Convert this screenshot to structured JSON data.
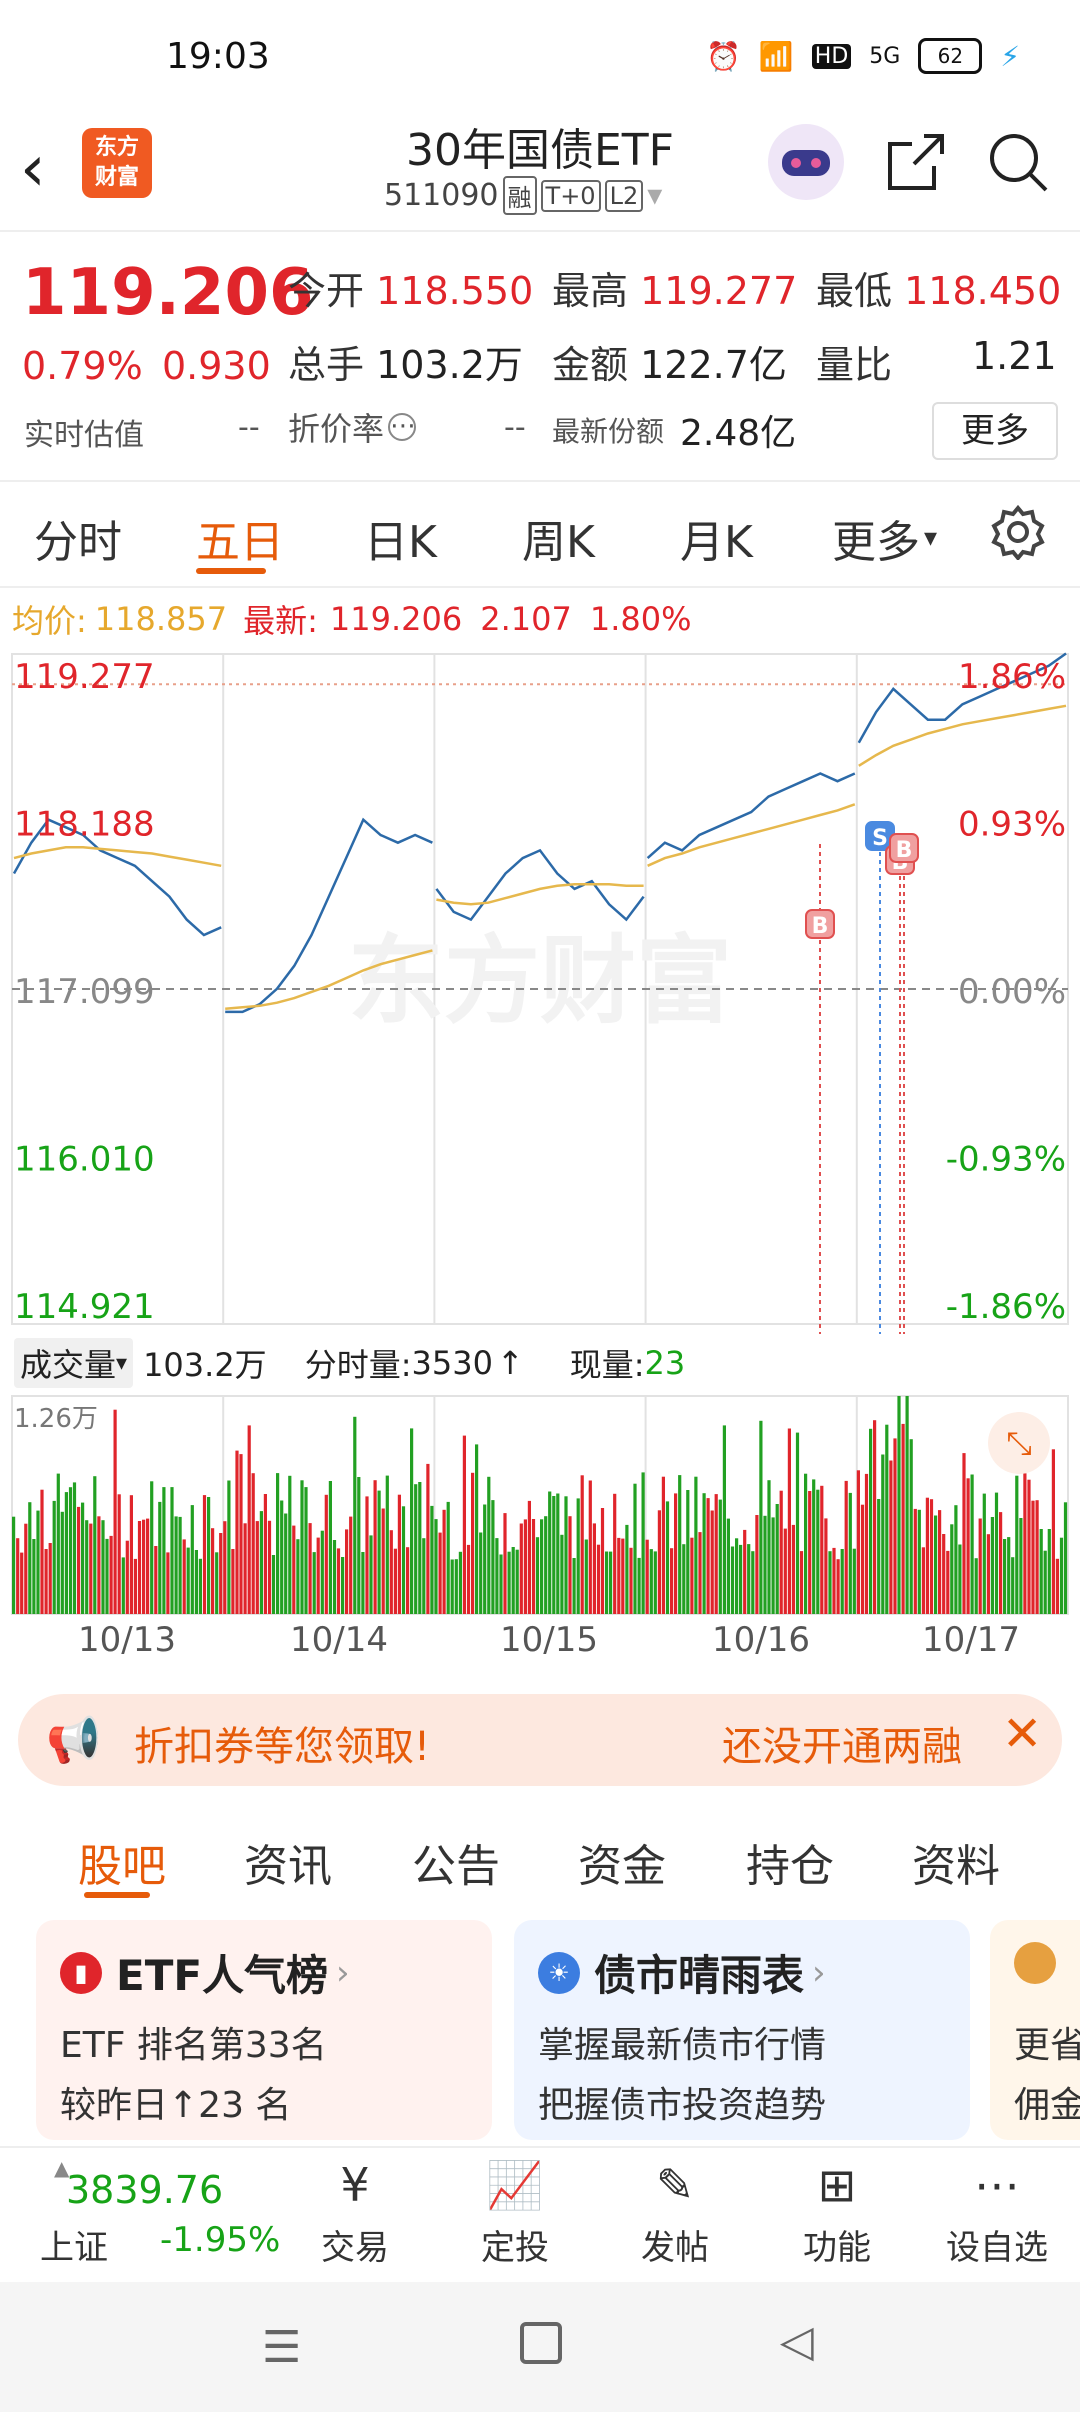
{
  "status_bar": {
    "time": "19:03",
    "network": "5G",
    "hd": "HD",
    "battery": "62"
  },
  "header": {
    "logo_text": [
      "东方",
      "财富"
    ],
    "title": "30年国债ETF",
    "code": "511090",
    "tags": [
      "融",
      "T+0",
      "L2"
    ]
  },
  "quote": {
    "price": "119.206",
    "change_pct": "0.79%",
    "change": "0.930",
    "open_label": "今开",
    "open": "118.550",
    "high_label": "最高",
    "high": "119.277",
    "low_label": "最低",
    "low": "118.450",
    "volume_label": "总手",
    "volume": "103.2万",
    "amount_label": "金额",
    "amount": "122.7亿",
    "ratio_label": "量比",
    "ratio": "1.21",
    "iopv_label": "实时估值",
    "iopv": "--",
    "premium_label": "折价率",
    "premium": "--",
    "shares_label": "最新份额",
    "shares": "2.48亿",
    "more_button": "更多"
  },
  "chart_tabs": [
    {
      "label": "分时",
      "active": false
    },
    {
      "label": "五日",
      "active": true
    },
    {
      "label": "日K",
      "active": false
    },
    {
      "label": "周K",
      "active": false
    },
    {
      "label": "月K",
      "active": false
    },
    {
      "label": "更多",
      "active": false
    }
  ],
  "avg_info": {
    "avg_label": "均价:",
    "avg": "118.857",
    "latest_label": "最新:",
    "latest": "119.206",
    "change": "2.107",
    "change_pct": "1.80%"
  },
  "chart_data": {
    "type": "line",
    "title": "",
    "x_labels": [
      "10/13",
      "10/14",
      "10/15",
      "10/16",
      "10/17"
    ],
    "y_left_ticks": [
      "119.277",
      "118.188",
      "117.099",
      "116.010",
      "114.921"
    ],
    "y_right_ticks": [
      "1.86%",
      "0.93%",
      "0.00%",
      "-0.93%",
      "-1.86%"
    ],
    "ylim": [
      114.921,
      119.277
    ],
    "prev_close": 117.099,
    "watermark": "东方财富",
    "series": [
      {
        "name": "最新",
        "color": "#2c6aa8",
        "days": [
          [
            117.85,
            118.05,
            118.2,
            118.15,
            118.1,
            118.0,
            117.95,
            117.9,
            117.8,
            117.7,
            117.55,
            117.45,
            117.5
          ],
          [
            116.95,
            116.95,
            117.0,
            117.1,
            117.25,
            117.45,
            117.7,
            117.95,
            118.2,
            118.1,
            118.05,
            118.1,
            118.05
          ],
          [
            117.75,
            117.6,
            117.55,
            117.7,
            117.85,
            117.95,
            118.0,
            117.85,
            117.75,
            117.8,
            117.65,
            117.55,
            117.7
          ],
          [
            117.95,
            118.05,
            118.0,
            118.1,
            118.15,
            118.2,
            118.25,
            118.35,
            118.4,
            118.45,
            118.5,
            118.45,
            118.5
          ],
          [
            118.7,
            118.9,
            119.05,
            118.95,
            118.85,
            118.85,
            118.95,
            119.0,
            119.05,
            119.1,
            119.15,
            119.2,
            119.28
          ]
        ]
      },
      {
        "name": "均价",
        "color": "#e6b84d",
        "days": [
          [
            117.95,
            117.98,
            118.0,
            118.02,
            118.02,
            118.01,
            118.0,
            117.99,
            117.98,
            117.96,
            117.94,
            117.92,
            117.9
          ],
          [
            116.97,
            116.98,
            116.99,
            117.01,
            117.04,
            117.08,
            117.12,
            117.17,
            117.22,
            117.26,
            117.29,
            117.32,
            117.35
          ],
          [
            117.68,
            117.66,
            117.65,
            117.66,
            117.69,
            117.72,
            117.75,
            117.77,
            117.78,
            117.78,
            117.78,
            117.77,
            117.77
          ],
          [
            117.9,
            117.95,
            117.98,
            118.02,
            118.05,
            118.08,
            118.11,
            118.14,
            118.17,
            118.2,
            118.23,
            118.26,
            118.3
          ],
          [
            118.55,
            118.62,
            118.68,
            118.72,
            118.76,
            118.79,
            118.82,
            118.84,
            118.86,
            118.88,
            118.9,
            118.92,
            118.94
          ]
        ]
      }
    ],
    "markers": [
      "B",
      "S",
      "B",
      "B"
    ]
  },
  "volume": {
    "selector": "成交量",
    "total": "103.2万",
    "tick_label": "分时量:",
    "tick_value": "3530",
    "current_label": "现量:",
    "current_value": "23",
    "max_label": "1.26万"
  },
  "promo": {
    "left_text": "折扣券等您领取!",
    "right_text": "还没开通两融"
  },
  "info_tabs": [
    {
      "label": "股吧",
      "active": true
    },
    {
      "label": "资讯",
      "active": false
    },
    {
      "label": "公告",
      "active": false
    },
    {
      "label": "资金",
      "active": false
    },
    {
      "label": "持仓",
      "active": false
    },
    {
      "label": "资料",
      "active": false
    }
  ],
  "cards": [
    {
      "title": "ETF人气榜",
      "line1": "ETF 排名第33名",
      "line2": "较昨日↑23 名"
    },
    {
      "title": "债市晴雨表",
      "line1": "掌握最新债市行情",
      "line2": "把握债市投资趋势"
    },
    {
      "title": "",
      "line1": "更省",
      "line2": "佣金"
    }
  ],
  "bottom_nav": {
    "index_value": "3839.76",
    "index_name": "上证",
    "index_change": "-1.95%",
    "items": [
      "交易",
      "定投",
      "发帖",
      "功能",
      "设自选"
    ]
  }
}
